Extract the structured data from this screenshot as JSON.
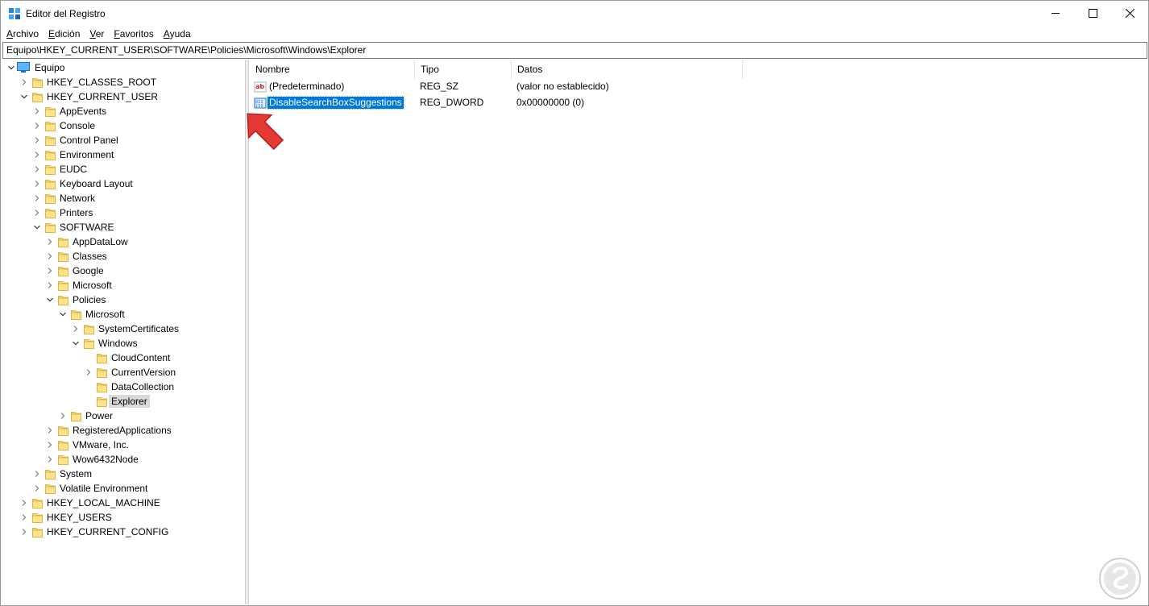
{
  "window": {
    "title": "Editor del Registro"
  },
  "menu": [
    {
      "accel": "A",
      "rest": "rchivo"
    },
    {
      "accel": "E",
      "rest": "dición"
    },
    {
      "accel": "V",
      "rest": "er"
    },
    {
      "accel": "F",
      "rest": "avoritos"
    },
    {
      "accel": "A",
      "rest": "yuda"
    }
  ],
  "address": "Equipo\\HKEY_CURRENT_USER\\SOFTWARE\\Policies\\Microsoft\\Windows\\Explorer",
  "tree": {
    "root": "Equipo",
    "hkcr": "HKEY_CLASSES_ROOT",
    "hkcu": "HKEY_CURRENT_USER",
    "hkcu_children": [
      "AppEvents",
      "Console",
      "Control Panel",
      "Environment",
      "EUDC",
      "Keyboard Layout",
      "Network",
      "Printers",
      "SOFTWARE"
    ],
    "software_children": [
      "AppDataLow",
      "Classes",
      "Google",
      "Microsoft",
      "Policies"
    ],
    "policies_children": [
      "Microsoft"
    ],
    "policies_ms_children": [
      "SystemCertificates",
      "Windows"
    ],
    "windows_children": [
      "CloudContent",
      "CurrentVersion",
      "DataCollection",
      "Explorer"
    ],
    "policies_tail": [
      "Power"
    ],
    "software_tail": [
      "RegisteredApplications",
      "VMware, Inc.",
      "Wow6432Node"
    ],
    "hkcu_tail": [
      "System",
      "Volatile Environment"
    ],
    "hklm": "HKEY_LOCAL_MACHINE",
    "hku": "HKEY_USERS",
    "hkcc": "HKEY_CURRENT_CONFIG"
  },
  "list": {
    "columns": [
      "Nombre",
      "Tipo",
      "Datos"
    ],
    "rows": [
      {
        "name": "(Predeterminado)",
        "type": "REG_SZ",
        "data": "(valor no establecido)",
        "icon": "string-value-icon"
      },
      {
        "name": "DisableSearchBoxSuggestions",
        "type": "REG_DWORD",
        "data": "0x00000000 (0)",
        "icon": "dword-value-icon"
      }
    ]
  },
  "colors": {
    "selection": "#0078d7",
    "folder": "#f8d775",
    "arrow": "#e53935"
  }
}
